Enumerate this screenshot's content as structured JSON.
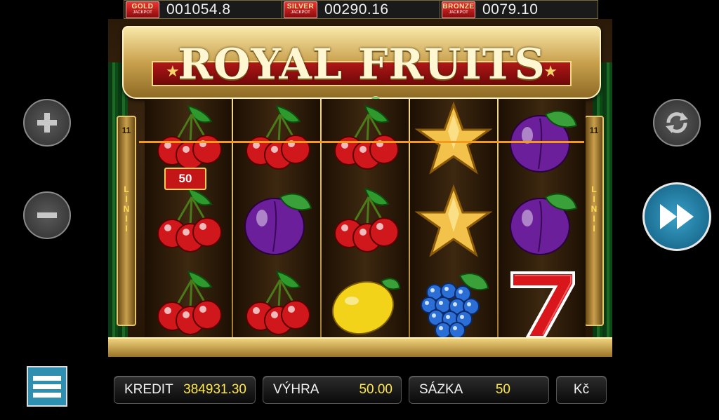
{
  "jackpots": [
    {
      "name": "GOLD",
      "sub": "JACKPOT",
      "value": "001054.8"
    },
    {
      "name": "SILVER",
      "sub": "JACKPOT",
      "value": "00290.16"
    },
    {
      "name": "BRONZE",
      "sub": "JACKPOT",
      "value": "0079.10"
    }
  ],
  "game": {
    "title": "ROYAL FRUITS",
    "lines_count": "11",
    "lines_word": "LINII"
  },
  "reels": [
    [
      "cherries",
      "cherries",
      "cherries"
    ],
    [
      "cherries",
      "plum",
      "cherries"
    ],
    [
      "cherries",
      "cherries",
      "lemon"
    ],
    [
      "star",
      "star",
      "grapes"
    ],
    [
      "plum",
      "plum",
      "seven"
    ]
  ],
  "win": {
    "amount_badge": "50",
    "line_color": "#f39a1a"
  },
  "controls": {
    "plus_icon": "plus-icon",
    "minus_icon": "minus-icon",
    "autoplay_icon": "autoplay-icon",
    "turbo_icon": "fast-forward-icon",
    "menu_icon": "hamburger-menu-icon"
  },
  "bottom_bar": {
    "credit_label": "KREDIT",
    "credit_value": "384931.30",
    "win_label": "VÝHRA",
    "win_value": "50.00",
    "bet_label": "SÁZKA",
    "bet_value": "50",
    "currency": "Kč"
  }
}
